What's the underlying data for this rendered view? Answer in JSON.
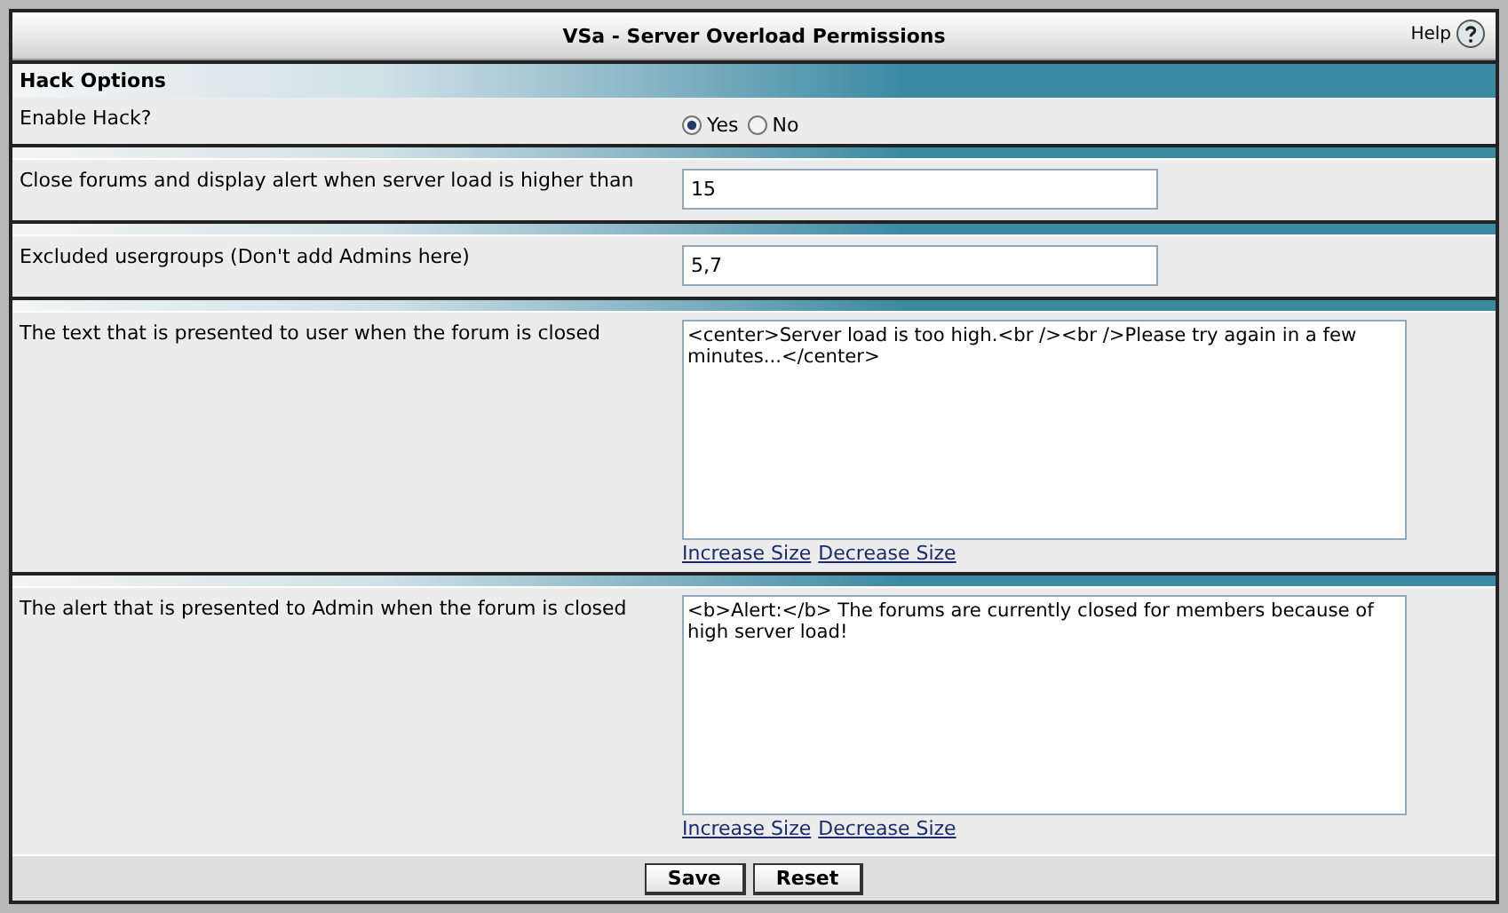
{
  "window": {
    "title": "VSa - Server Overload Permissions",
    "help": "Help"
  },
  "section": {
    "title": "Hack Options"
  },
  "rows": [
    {
      "kind": "radio",
      "label": "Enable Hack?",
      "options": [
        {
          "label": "Yes",
          "selected": true
        },
        {
          "label": "No",
          "selected": false
        }
      ]
    },
    {
      "kind": "text",
      "label": "Close forums and display alert when server load is higher than",
      "value": "15"
    },
    {
      "kind": "text",
      "label": "Excluded usergroups (Don't add Admins here)",
      "value": "5,7"
    },
    {
      "kind": "textarea",
      "label": "The text that is presented to user when the forum is closed",
      "value": "<center>Server load is too high.<br /><br />Please try again in a few minutes...</center>",
      "links": [
        "Increase Size",
        "Decrease Size"
      ]
    },
    {
      "kind": "textarea",
      "label": "The alert that is presented to Admin when the forum is closed",
      "value": "<b>Alert:</b> The forums are currently closed for members because of high server load!",
      "links": [
        "Increase Size",
        "Decrease Size"
      ]
    }
  ],
  "buttons": [
    "Save",
    "Reset"
  ]
}
